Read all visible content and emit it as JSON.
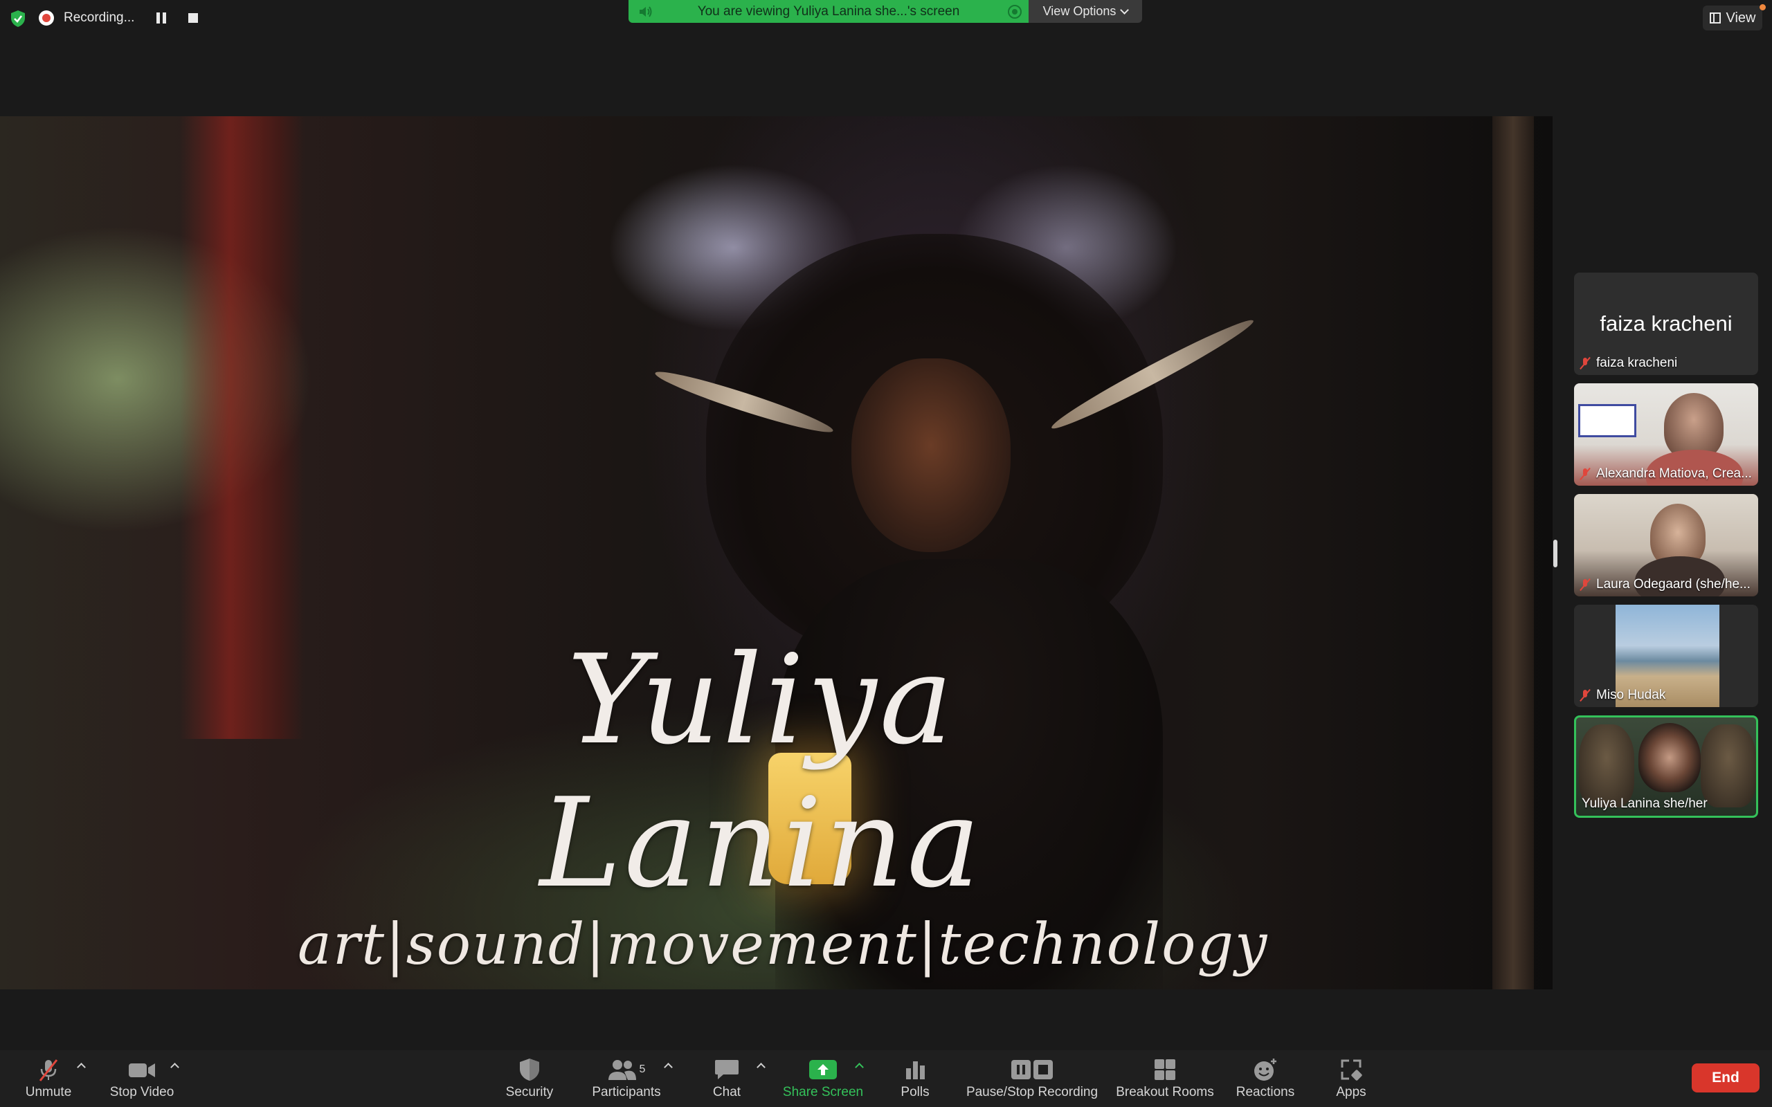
{
  "top_bar": {
    "recording_label": "Recording...",
    "share_banner_text": "You are viewing Yuliya Lanina she...'s screen",
    "view_options_label": "View Options",
    "view_label": "View"
  },
  "shared_screen": {
    "title": "Yuliya Lanina",
    "subtitle": "art|sound|movement|technology"
  },
  "participants": [
    {
      "display_name": "faiza kracheni",
      "label": "faiza kracheni",
      "muted": true,
      "video": false
    },
    {
      "label": "Alexandra Matiova, Crea...",
      "muted": true,
      "video": true
    },
    {
      "label": "Laura Odegaard (she/he...",
      "muted": true,
      "video": true
    },
    {
      "label": "Miso Hudak",
      "muted": true,
      "video": true
    },
    {
      "label": "Yuliya Lanina she/her",
      "muted": false,
      "video": true,
      "active_speaker": true
    }
  ],
  "toolbar": {
    "unmute": "Unmute",
    "stop_video": "Stop Video",
    "security": "Security",
    "participants": "Participants",
    "participants_count": "5",
    "chat": "Chat",
    "share_screen": "Share Screen",
    "polls": "Polls",
    "pause_stop_recording": "Pause/Stop Recording",
    "breakout_rooms": "Breakout Rooms",
    "reactions": "Reactions",
    "apps": "Apps",
    "end": "End"
  },
  "colors": {
    "share_banner": "#2bb24c",
    "active_speaker_border": "#34c15a",
    "end_button": "#d9362b",
    "recording_dot": "#e0463c"
  },
  "icons": [
    "shield-check-icon",
    "recording-icon",
    "pause-icon",
    "stop-icon",
    "speaker-icon",
    "view-icon",
    "microphone-muted-icon",
    "video-camera-icon",
    "security-shield-icon",
    "participants-icon",
    "chat-bubble-icon",
    "share-screen-icon",
    "polls-icon",
    "pause-stop-recording-icon",
    "breakout-rooms-icon",
    "reactions-icon",
    "apps-icon"
  ]
}
